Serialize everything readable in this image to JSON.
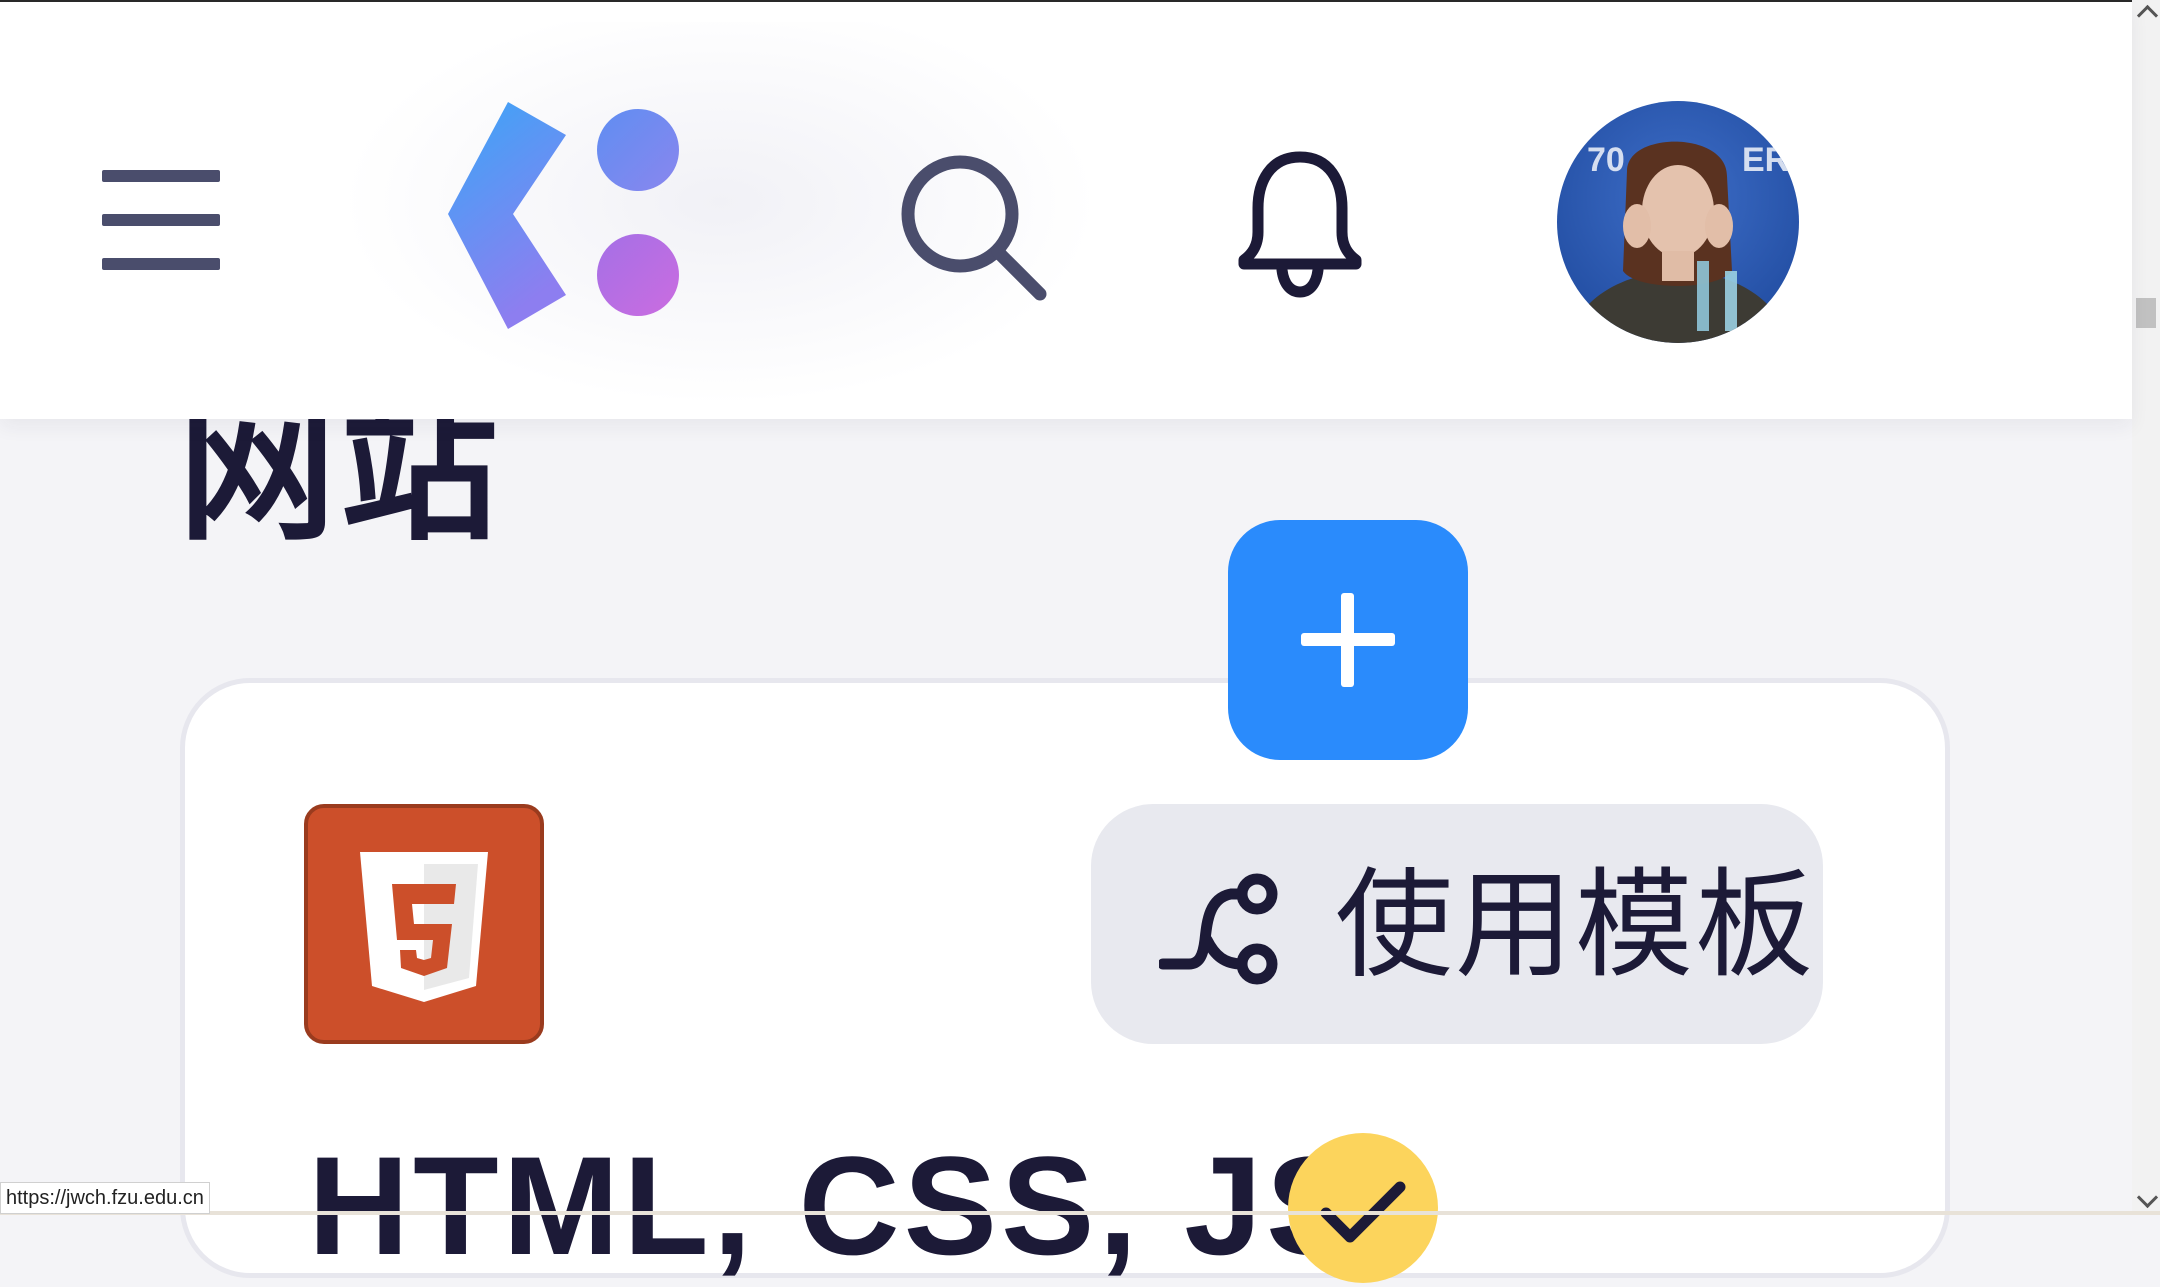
{
  "header": {
    "menu_icon": "hamburger-menu-icon",
    "logo_icon": "app-logo",
    "search_icon": "search-icon",
    "bell_icon": "bell-icon",
    "avatar": "user-avatar-photo"
  },
  "colors": {
    "accent_blue": "#2a8bfc",
    "logo_gradient_start": "#3aa6f7",
    "logo_gradient_end": "#c06bdd",
    "dark_text": "#1c1a37",
    "icon_gray": "#4a4d6c",
    "html5_orange": "#cc4f2a",
    "badge_yellow": "#fcd45c"
  },
  "main": {
    "section_title": "网站",
    "add_button_icon": "plus-icon",
    "card": {
      "tech_icon": "html5-icon",
      "template_button_label": "使用模板",
      "template_button_icon": "template-flow-icon",
      "title": "HTML, CSS, JS",
      "status_icon": "check-icon"
    }
  },
  "status_bar": {
    "url": "https://jwch.fzu.edu.cn"
  }
}
